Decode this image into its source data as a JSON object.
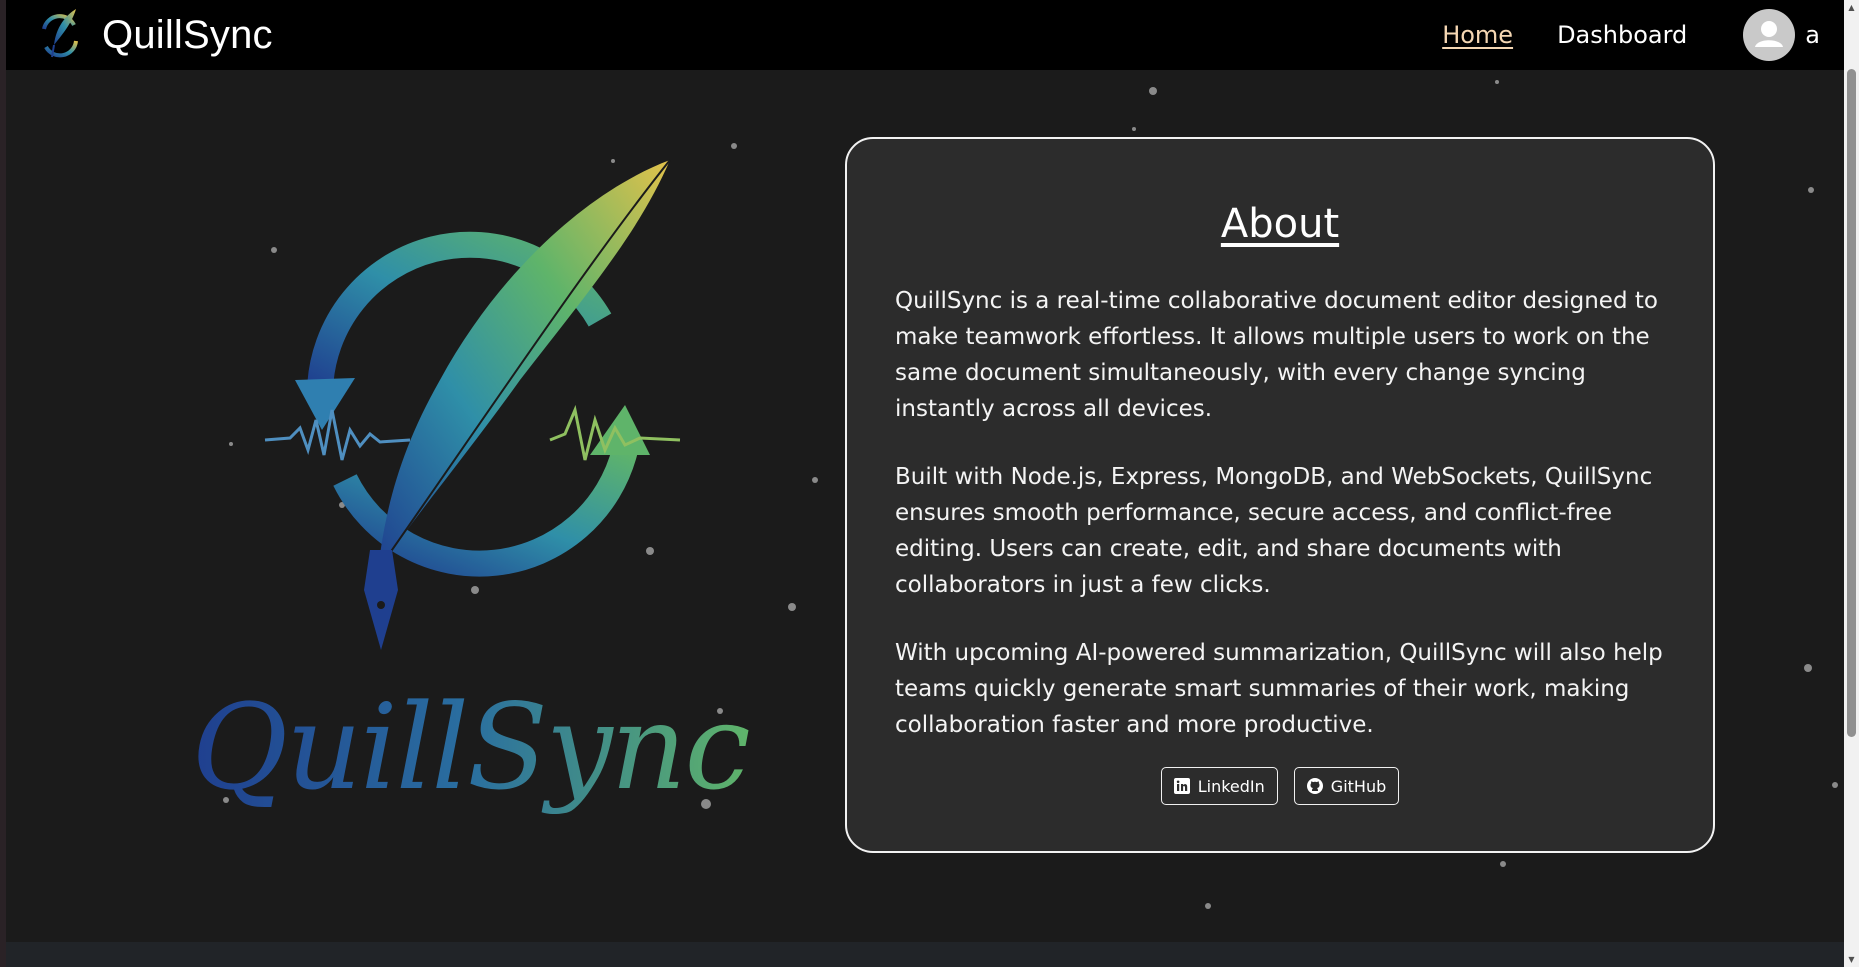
{
  "navbar": {
    "brand": "QuillSync",
    "links": {
      "home": "Home",
      "dashboard": "Dashboard"
    },
    "user": {
      "name": "a",
      "icon": "user-avatar-icon"
    }
  },
  "hero": {
    "logo_icon": "quillsync-feather-logo",
    "logo_wordmark": "QuillSync"
  },
  "about": {
    "title": "About",
    "paragraphs": [
      "QuillSync is a real-time collaborative document editor designed to make teamwork effortless. It allows multiple users to work on the same document simultaneously, with every change syncing instantly across all devices.",
      "Built with Node.js, Express, MongoDB, and WebSockets, QuillSync ensures smooth performance, secure access, and conflict-free editing. Users can create, edit, and share documents with collaborators in just a few clicks.",
      "With upcoming AI-powered summarization, QuillSync will also help teams quickly generate smart summaries of their work, making collaboration faster and more productive."
    ],
    "buttons": {
      "linkedin": "LinkedIn",
      "github": "GitHub"
    }
  },
  "colors": {
    "background": "#1b1b1b",
    "navbar": "#000000",
    "card": "#2c2c2c",
    "home_link": "#f5d7b3",
    "logo_gradient": [
      "#1f3f8f",
      "#2f8fa8",
      "#5fb46a",
      "#e3c24a"
    ]
  }
}
